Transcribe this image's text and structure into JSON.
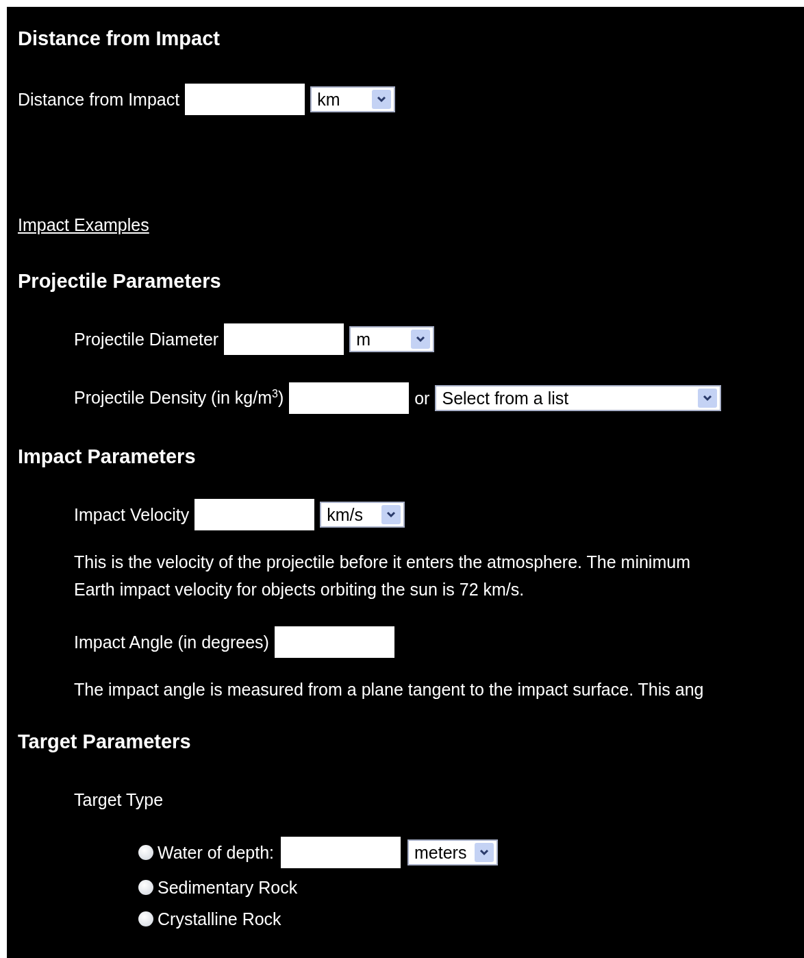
{
  "top": {
    "heading": "Distance from Impact",
    "field": {
      "label": "Distance from Impact",
      "select": "km"
    }
  },
  "link": "Impact Examples",
  "sections": [
    {
      "heading": "Projectile Parameters",
      "items": [
        {
          "kind": "field",
          "label": "Projectile Diameter",
          "select": "m"
        },
        {
          "kind": "field",
          "label": "Projectile Density (in kg/m$^{3}$)",
          "connector": "or",
          "select": "Select from a list",
          "wide": true
        }
      ]
    },
    {
      "heading": "Impact Parameters",
      "items": [
        {
          "kind": "field",
          "label": "Impact Velocity",
          "select": "km/s"
        },
        {
          "kind": "paragraph",
          "lines": [
            "This is the velocity of the projectile before it enters the atmosphere. The minimum",
            "Earth impact velocity for objects orbiting the sun is 72 km/s."
          ]
        },
        {
          "kind": "field",
          "label": "Impact Angle (in degrees)"
        },
        {
          "kind": "paragraph",
          "lines": [
            "The impact angle is measured from a plane tangent to the impact surface. This ang"
          ]
        }
      ]
    },
    {
      "heading": "Target Parameters",
      "items": [
        {
          "kind": "label",
          "text": "Target Type"
        },
        {
          "kind": "radios",
          "options": [
            {
              "label": "Water of depth:",
              "selected": false,
              "field": true,
              "select": "meters"
            },
            {
              "label": "Sedimentary Rock",
              "selected": false
            },
            {
              "label": "Crystalline Rock",
              "selected": false
            }
          ]
        }
      ]
    }
  ]
}
